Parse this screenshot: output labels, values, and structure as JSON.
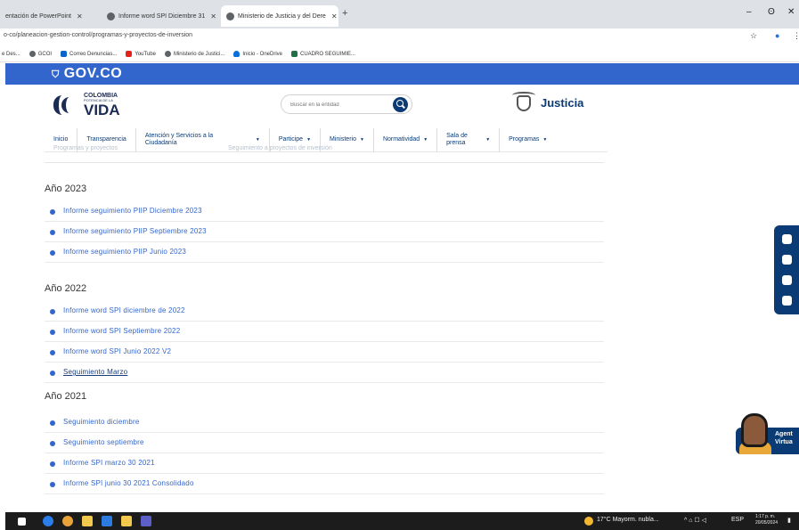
{
  "browser": {
    "tabs": [
      {
        "label": "entación de PowerPoint",
        "active": false
      },
      {
        "label": "Informe word SPI Diciembre 31",
        "active": false
      },
      {
        "label": "Ministerio de Justicia y del Dere",
        "active": true
      }
    ],
    "new_tab": "+",
    "controls": {
      "minimize": "–",
      "restore": "ʘ",
      "close": "✕"
    },
    "url": "o-co/planeacion-gestion-control/programas-y-proyectos-de-inversion",
    "star": "☆",
    "bookmarks": [
      "e Des...",
      "GCOI",
      "Correo Denuncias...",
      "YouTube",
      "Ministerio de Justici...",
      "Inicio - OneDrive",
      "CUADRO SEGUIMIE..."
    ]
  },
  "gov": {
    "logo": "GOV.CO"
  },
  "header": {
    "brand_line1": "COLOMBIA",
    "brand_line2": "POTENCIA DE LA",
    "brand_line3": "VIDA",
    "search_placeholder": "Buscar en la entidad",
    "entity": "Justicia"
  },
  "nav": {
    "items": [
      {
        "label": "Inicio",
        "has_menu": false
      },
      {
        "label": "Transparencia",
        "has_menu": false
      },
      {
        "label": "Atención y Servicios a la Ciudadanía",
        "has_menu": true
      },
      {
        "label": "Participe",
        "has_menu": true
      },
      {
        "label": "Ministerio",
        "has_menu": true
      },
      {
        "label": "Normatividad",
        "has_menu": true
      },
      {
        "label": "Sala de prensa",
        "has_menu": true
      },
      {
        "label": "Programas",
        "has_menu": true
      }
    ],
    "caret": "▼"
  },
  "faded_bar": {
    "left": "Programas y proyectos",
    "right": "Seguimiento a proyectos de inversión"
  },
  "sections": [
    {
      "year": "Año 2023",
      "items": [
        {
          "label": "Informe seguimiento PIIP Diciembre 2023",
          "visited": false
        },
        {
          "label": "Informe seguimiento PIIP Septiembre 2023",
          "visited": false
        },
        {
          "label": "Informe seguimiento PIIP Junio 2023",
          "visited": false
        }
      ]
    },
    {
      "year": "Año 2022",
      "items": [
        {
          "label": "Informe word SPI diciembre de 2022",
          "visited": false
        },
        {
          "label": "Informe word SPI Septiembre 2022",
          "visited": false
        },
        {
          "label": "Informe word SPI  Junio 2022 V2",
          "visited": false
        },
        {
          "label": "Seguimiento Marzo",
          "visited": true
        }
      ]
    },
    {
      "year": "Año 2021",
      "items": [
        {
          "label": "Seguimiento diciembre",
          "visited": false
        },
        {
          "label": "Seguimiento septiembre",
          "visited": false
        },
        {
          "label": "Informe SPI marzo 30 2021",
          "visited": false
        },
        {
          "label": "Informe SPI junio 30 2021 Consolidado",
          "visited": false
        }
      ]
    }
  ],
  "agent": {
    "line1": "Agent",
    "line2": "Virtua"
  },
  "taskbar": {
    "weather": "17°C  Mayorm. nubla...",
    "lang": "ESP",
    "time": "1:17 p. m.",
    "date": "20/05/2024"
  },
  "colors": {
    "gov_blue": "#3366cc",
    "navy": "#0b3b75",
    "link": "#3366cc"
  }
}
